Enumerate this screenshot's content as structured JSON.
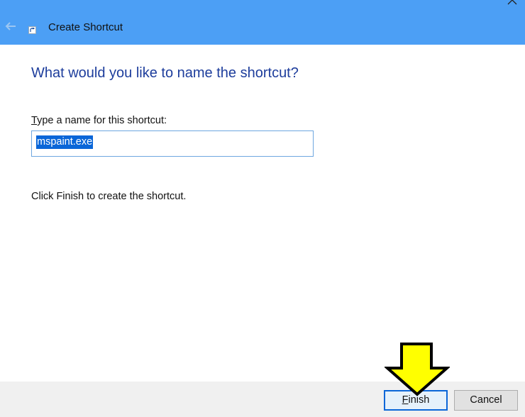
{
  "window": {
    "title": "Create Shortcut"
  },
  "page": {
    "heading": "What would you like to name the shortcut?",
    "field_label_mnemonic": "T",
    "field_label_rest": "ype a name for this shortcut:",
    "name_value": "mspaint.exe",
    "hint": "Click Finish to create the shortcut."
  },
  "buttons": {
    "finish_mnemonic": "F",
    "finish_rest": "inish",
    "cancel": "Cancel"
  },
  "colors": {
    "titlebar": "#4c9ff5",
    "heading": "#1d3d9c",
    "selection": "#0a66d8",
    "annotation_arrow": "#ffff00"
  },
  "icons": {
    "back": "back-arrow-icon",
    "app": "shortcut-icon",
    "close": "close-icon",
    "annotation": "down-arrow-annotation"
  }
}
